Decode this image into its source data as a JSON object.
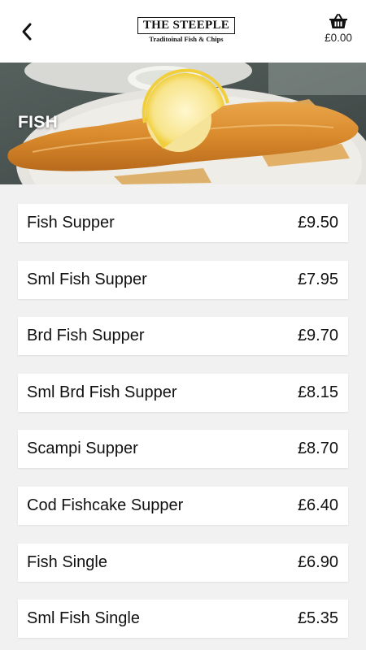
{
  "header": {
    "logo_title": "THE STEEPLE",
    "logo_subtitle": "Traditoinal Fish & Chips",
    "cart_total": "£0.00",
    "back_icon": "chevron-left-icon",
    "cart_icon": "basket-icon"
  },
  "category": {
    "title": "FISH"
  },
  "menu": {
    "items": [
      {
        "name": "Fish Supper",
        "price": "£9.50"
      },
      {
        "name": "Sml Fish Supper",
        "price": "£7.95"
      },
      {
        "name": "Brd Fish Supper",
        "price": "£9.70"
      },
      {
        "name": "Sml Brd Fish Supper",
        "price": "£8.15"
      },
      {
        "name": "Scampi Supper",
        "price": "£8.70"
      },
      {
        "name": "Cod Fishcake Supper",
        "price": "£6.40"
      },
      {
        "name": "Fish Single",
        "price": "£6.90"
      },
      {
        "name": "Sml Fish Single",
        "price": "£5.35"
      }
    ]
  },
  "colors": {
    "background": "#f1f1f1",
    "card": "#ffffff",
    "text": "#111111"
  }
}
